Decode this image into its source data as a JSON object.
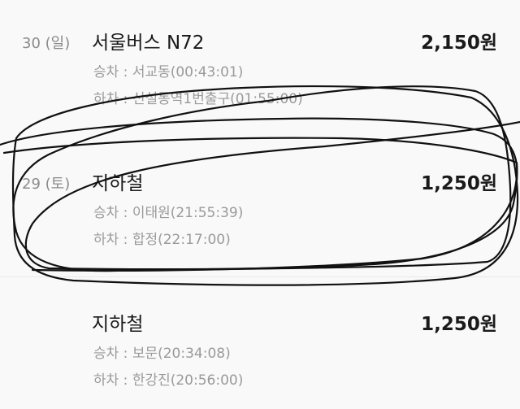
{
  "records": [
    {
      "date": "30 (일)",
      "title": "서울버스 N72",
      "fare": "2,150원",
      "board": "승차 : 서교동(00:43:01)",
      "alight": "하차 : 신설동역1번출구(01:55:00)"
    },
    {
      "date": "29 (토)",
      "title": "지하철",
      "fare": "1,250원",
      "board": "승차 : 이태원(21:55:39)",
      "alight": "하차 : 합정(22:17:00)"
    },
    {
      "date": "",
      "title": "지하철",
      "fare": "1,250원",
      "board": "승차 : 보문(20:34:08)",
      "alight": "하차 : 한강진(20:56:00)"
    }
  ],
  "colors": {
    "background": "#f9f9f9",
    "primary_text": "#1a1a1a",
    "secondary_text": "#9a9a9a",
    "scribble": "#111111"
  }
}
